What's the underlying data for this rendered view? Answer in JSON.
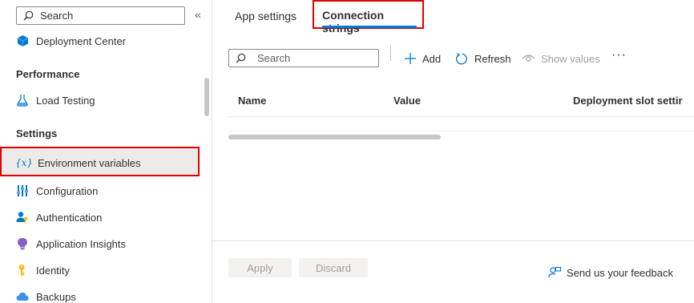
{
  "sidebar": {
    "search_placeholder": "Search",
    "collapse_glyph": "«",
    "items": {
      "deployment_center": "Deployment Center",
      "load_testing": "Load Testing",
      "environment_variables": "Environment variables",
      "configuration": "Configuration",
      "authentication": "Authentication",
      "application_insights": "Application Insights",
      "identity": "Identity",
      "backups": "Backups"
    },
    "sections": {
      "performance": "Performance",
      "settings": "Settings"
    }
  },
  "tabs": {
    "app_settings": "App settings",
    "connection_strings": "Connection strings"
  },
  "toolbar": {
    "search_placeholder": "Search",
    "add": "Add",
    "refresh": "Refresh",
    "show_values": "Show values",
    "more": "···"
  },
  "table": {
    "columns": [
      "Name",
      "Value",
      "Deployment slot settir"
    ]
  },
  "footer": {
    "apply": "Apply",
    "discard": "Discard",
    "feedback": "Send us your feedback"
  },
  "colors": {
    "accent": "#0078d4",
    "highlight_box": "#e00000"
  }
}
